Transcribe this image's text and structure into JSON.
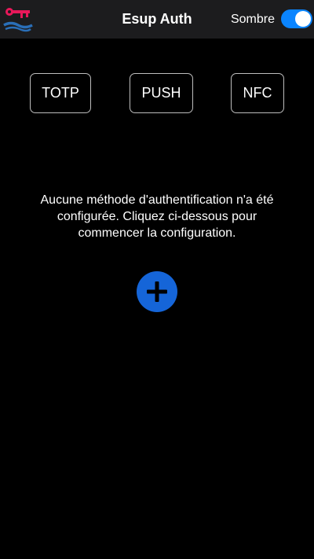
{
  "header": {
    "title": "Esup Auth",
    "theme_toggle": {
      "label": "Sombre",
      "enabled": true
    }
  },
  "methods": [
    {
      "label": "TOTP"
    },
    {
      "label": "PUSH"
    },
    {
      "label": "NFC"
    }
  ],
  "main": {
    "empty_message": "Aucune méthode d'authentification n'a été configurée. Cliquez ci-dessous pour commencer la configuration."
  },
  "icons": {
    "logo": "key-wave-logo-icon",
    "add": "plus-icon"
  },
  "colors": {
    "background": "#000000",
    "header_background": "#1c1c1e",
    "toggle_on": "#0a84ff",
    "add_button": "#1565d8",
    "logo_key": "#e8185a",
    "logo_wave": "#2a6fb8"
  }
}
